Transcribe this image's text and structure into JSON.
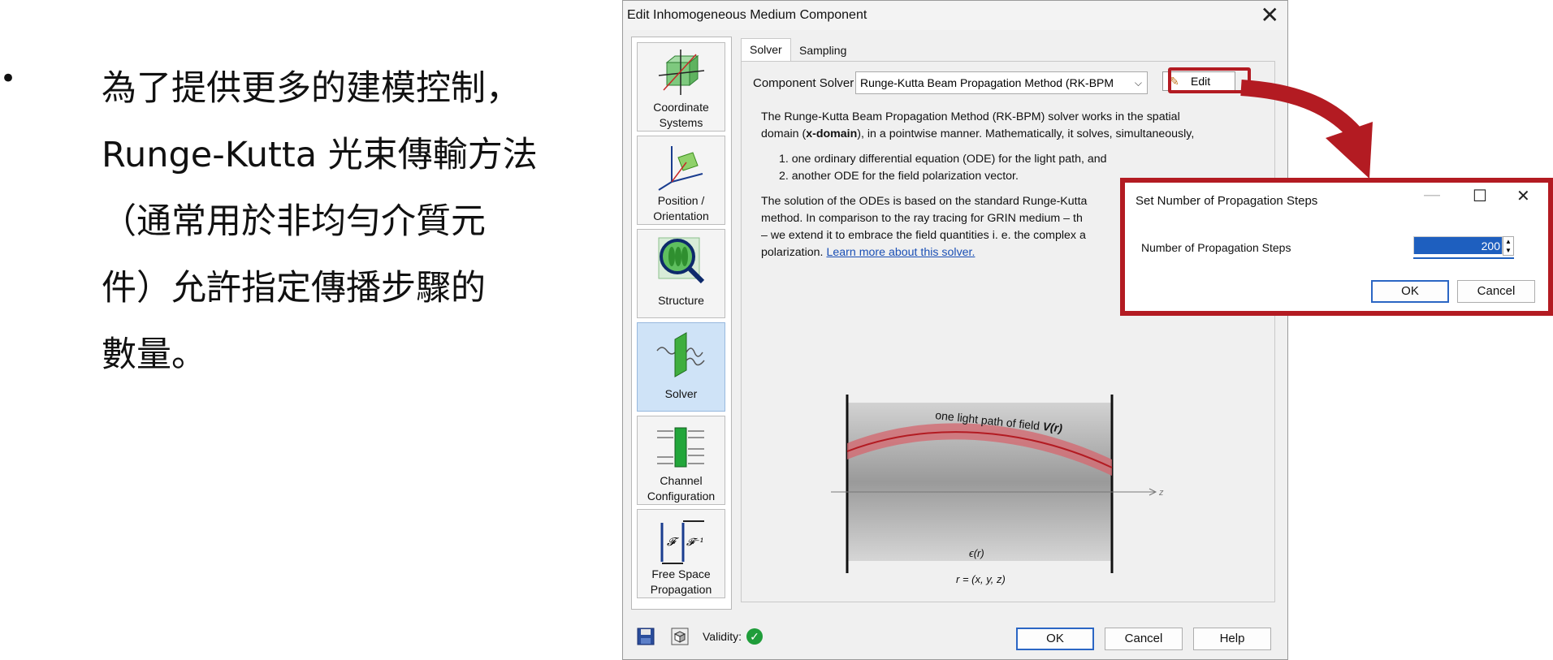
{
  "slide": {
    "bullet": "•",
    "lines": [
      "為了提供更多的建模控制，",
      "Runge-Kutta 光束傳輸方法",
      "（通常用於非均勻介質元",
      "件）允許指定傳播步驟的",
      "數量。"
    ]
  },
  "dialog": {
    "title": "Edit Inhomogeneous Medium Component",
    "close_glyph": "✕",
    "sidebar": [
      {
        "label1": "Coordinate",
        "label2": "Systems",
        "icon": "coordinate-systems-icon"
      },
      {
        "label1": "Position /",
        "label2": "Orientation",
        "icon": "position-orientation-icon"
      },
      {
        "label1": "Structure",
        "label2": "",
        "icon": "structure-icon"
      },
      {
        "label1": "Solver",
        "label2": "",
        "icon": "solver-icon",
        "active": true
      },
      {
        "label1": "Channel",
        "label2": "Configuration",
        "icon": "channel-configuration-icon"
      },
      {
        "label1": "Free Space",
        "label2": "Propagation",
        "icon": "free-space-propagation-icon"
      }
    ],
    "tabs": {
      "solver": "Solver",
      "sampling": "Sampling"
    },
    "component_solver_label": "Component Solver",
    "component_solver_value": "Runge-Kutta Beam Propagation Method (RK-BPM",
    "edit_label": "Edit",
    "description": {
      "p1a": "The Runge-Kutta Beam Propagation Method (RK-BPM) solver works in the spatial",
      "p1b": "domain (",
      "p1bold": "x-domain",
      "p1c": "), in a pointwise manner. Mathematically, it solves, simultaneously,",
      "li1": "1. one ordinary differential equation (ODE) for the light path, and",
      "li2": "2. another ODE for the field polarization vector.",
      "p2a": "The solution of the ODEs is based on the standard Runge-Kutta",
      "p2b": "method. In comparison to the ray tracing for GRIN medium – th",
      "p2c": "– we extend it to embrace the field quantities i. e. the complex a",
      "p2d": "polarization.",
      "link": "Learn more about this solver."
    },
    "figure": {
      "path_label": "one light path of field",
      "field_symbol": "V(r)",
      "axis": "z",
      "epsilon": "ϵ(r)",
      "position": "r = (x, y, z)"
    },
    "validity_label": "Validity:",
    "buttons": {
      "ok": "OK",
      "cancel": "Cancel",
      "help": "Help"
    }
  },
  "popup": {
    "title": "Set Number of Propagation Steps",
    "minimize": "—",
    "maximize": "☐",
    "close": "✕",
    "field_label": "Number of Propagation Steps",
    "value": "200",
    "ok": "OK",
    "cancel": "Cancel"
  },
  "colors": {
    "highlight_red": "#b31b22",
    "accent_blue": "#2b66c4",
    "valid_green": "#1f9d3a"
  }
}
